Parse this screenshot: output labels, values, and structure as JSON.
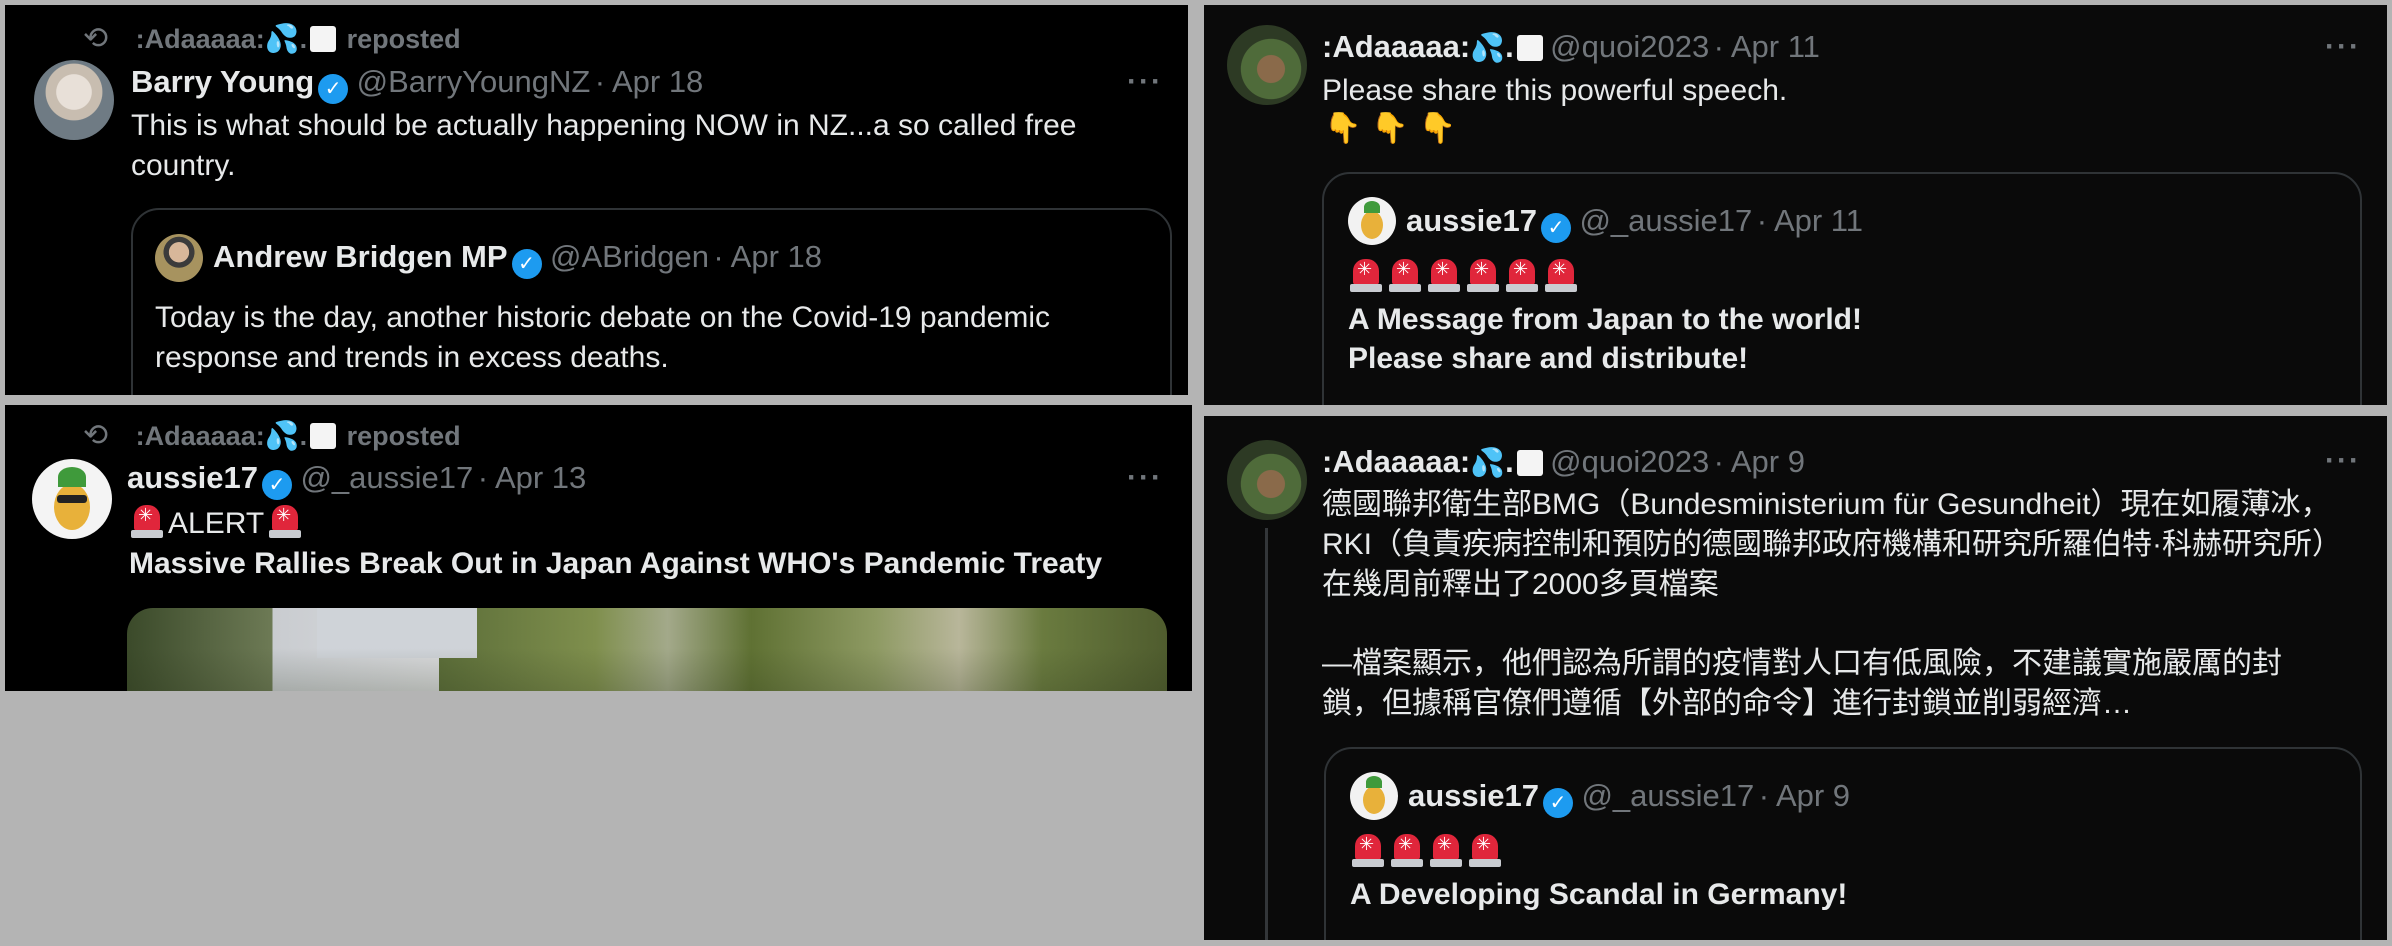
{
  "tweets": {
    "t1": {
      "repost_prefix": ":Adaaaaa:",
      "repost_label": "reposted",
      "author_name": "Barry Young",
      "author_handle": "@BarryYoungNZ",
      "date": "· Apr 18",
      "more": "···",
      "text": "This is what should be actually happening NOW in NZ...a so called free country.",
      "quote": {
        "author_name": "Andrew Bridgen MP",
        "author_handle": "@ABridgen",
        "date": "· Apr 18",
        "text": "Today is the day, another historic debate on the Covid-19 pandemic response and trends in excess deaths."
      }
    },
    "t2": {
      "author_name": ":Adaaaaa:",
      "author_handle": "@quoi2023",
      "date": "· Apr 11",
      "more": "···",
      "text": "Please share this powerful speech.",
      "hands_count": 3,
      "quote": {
        "author_name": "aussie17",
        "author_handle": "@_aussie17",
        "date": "· Apr 11",
        "sirens_count": 6,
        "line1": "A Message from Japan to the world!",
        "line2": "Please share and distribute!"
      }
    },
    "t3": {
      "repost_prefix": ":Adaaaaa:",
      "repost_label": "reposted",
      "author_name": "aussie17",
      "author_handle": "@_aussie17",
      "date": "· Apr 13",
      "more": "···",
      "alert": "ALERT",
      "headline": "Massive Rallies Break Out in Japan Against WHO's Pandemic Treaty"
    },
    "t4": {
      "author_name": ":Adaaaaa:",
      "author_handle": "@quoi2023",
      "date": "· Apr 9",
      "more": "···",
      "para1_line1": "德國聯邦衛生部BMG（Bundesministerium für Gesundheit）現在如履薄冰，",
      "para1_line2": "RKI（負責疾病控制和預防的德國聯邦政府機構和研究所羅伯特·科赫研究所）",
      "para1_line3": "在幾周前釋出了2000多頁檔案",
      "para2_line1": "—檔案顯示，他們認為所謂的疫情對人口有低風險，不建議實施嚴厲的封",
      "para2_line2": "鎖，但據稱官僚們遵循【外部的命令】進行封鎖並削弱經濟…",
      "quote": {
        "author_name": "aussie17",
        "author_handle": "@_aussie17",
        "date": "· Apr 9",
        "sirens_count": 4,
        "line1": "A Developing Scandal in Germany!"
      }
    }
  },
  "colors": {
    "background": "#b4b4b4",
    "panel": "#000000",
    "text": "#e7e9ea",
    "muted": "#71767b",
    "verified": "#1d9bf0",
    "border": "#2f3336"
  }
}
